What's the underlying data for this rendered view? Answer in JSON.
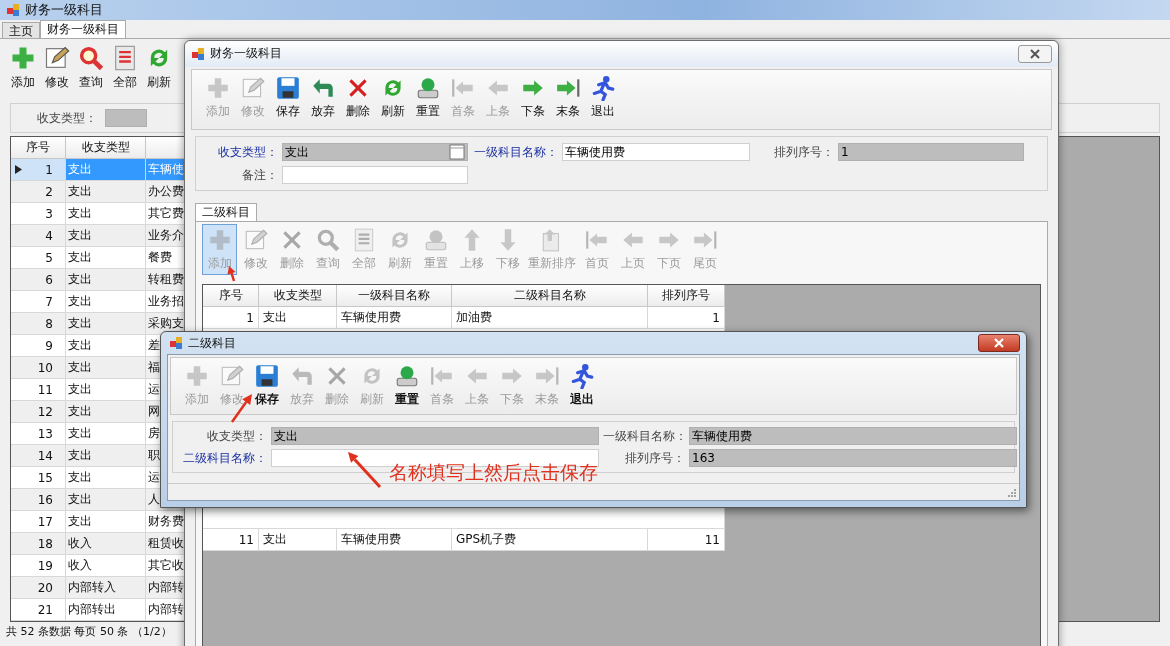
{
  "app_window": {
    "title": "财务一级科目",
    "tabs": [
      {
        "label": "主页",
        "selected": false
      },
      {
        "label": "财务一级科目",
        "selected": true
      }
    ],
    "toolbar": [
      {
        "kind": "add",
        "label": "添加"
      },
      {
        "kind": "edit",
        "label": "修改"
      },
      {
        "kind": "search",
        "label": "查询"
      },
      {
        "kind": "all",
        "label": "全部"
      },
      {
        "kind": "refresh",
        "label": "刷新"
      }
    ],
    "filter": {
      "label": "收支类型："
    },
    "table": {
      "columns": [
        "序号",
        "收支类型"
      ],
      "rows": [
        {
          "cells": [
            "1",
            "支出",
            "车辆使"
          ],
          "selected": true
        },
        {
          "cells": [
            "2",
            "支出",
            "办公费"
          ],
          "selected": false
        },
        {
          "cells": [
            "3",
            "支出",
            "其它费"
          ],
          "selected": false
        },
        {
          "cells": [
            "4",
            "支出",
            "业务介"
          ],
          "selected": false
        },
        {
          "cells": [
            "5",
            "支出",
            "餐费"
          ],
          "selected": false
        },
        {
          "cells": [
            "6",
            "支出",
            "转租费"
          ],
          "selected": false
        },
        {
          "cells": [
            "7",
            "支出",
            "业务招"
          ],
          "selected": false
        },
        {
          "cells": [
            "8",
            "支出",
            "采购支"
          ],
          "selected": false
        },
        {
          "cells": [
            "9",
            "支出",
            "差"
          ],
          "selected": false
        },
        {
          "cells": [
            "10",
            "支出",
            "福"
          ],
          "selected": false
        },
        {
          "cells": [
            "11",
            "支出",
            "运"
          ],
          "selected": false
        },
        {
          "cells": [
            "12",
            "支出",
            "网"
          ],
          "selected": false
        },
        {
          "cells": [
            "13",
            "支出",
            "房"
          ],
          "selected": false
        },
        {
          "cells": [
            "14",
            "支出",
            "职"
          ],
          "selected": false
        },
        {
          "cells": [
            "15",
            "支出",
            "运"
          ],
          "selected": false
        },
        {
          "cells": [
            "16",
            "支出",
            "人"
          ],
          "selected": false
        },
        {
          "cells": [
            "17",
            "支出",
            "财务费"
          ],
          "selected": false
        },
        {
          "cells": [
            "18",
            "收入",
            "租赁收"
          ],
          "selected": false
        },
        {
          "cells": [
            "19",
            "收入",
            "其它收"
          ],
          "selected": false
        },
        {
          "cells": [
            "20",
            "内部转入",
            "内部转"
          ],
          "selected": false
        },
        {
          "cells": [
            "21",
            "内部转出",
            "内部转"
          ],
          "selected": false
        }
      ]
    },
    "status_bar": "共 52 条数据 每页 50 条 （1/2）"
  },
  "main_window": {
    "title": "财务一级科目",
    "toolbar": [
      {
        "kind": "add",
        "label": "添加",
        "disabled": true
      },
      {
        "kind": "edit",
        "label": "修改",
        "disabled": true
      },
      {
        "kind": "save",
        "label": "保存",
        "disabled": false
      },
      {
        "kind": "undo",
        "label": "放弃",
        "disabled": false
      },
      {
        "kind": "delete",
        "label": "删除",
        "disabled": false
      },
      {
        "kind": "refresh",
        "label": "刷新",
        "disabled": false
      },
      {
        "kind": "reset",
        "label": "重置",
        "disabled": false
      },
      {
        "kind": "first",
        "label": "首条",
        "disabled": true
      },
      {
        "kind": "prev",
        "label": "上条",
        "disabled": true
      },
      {
        "kind": "next",
        "label": "下条",
        "disabled": false
      },
      {
        "kind": "last",
        "label": "末条",
        "disabled": false
      },
      {
        "kind": "exit",
        "label": "退出",
        "disabled": false
      }
    ],
    "form": [
      {
        "label": "收支类型：",
        "value": "支出",
        "required": true,
        "readonly": true,
        "picker": true
      },
      {
        "label": "一级科目名称：",
        "value": "车辆使用费",
        "required": true,
        "readonly": false,
        "picker": false
      },
      {
        "label": "排列序号：",
        "value": "1",
        "required": false,
        "readonly": true,
        "picker": false
      },
      {
        "label": "备注：",
        "required": false,
        "readonly": false,
        "picker": false
      }
    ],
    "tabs": [
      {
        "label": "二级科目",
        "selected": true
      }
    ],
    "sub_toolbar": [
      {
        "kind": "add",
        "label": "添加",
        "disabled": true,
        "hovered": true
      },
      {
        "kind": "edit",
        "label": "修改",
        "disabled": true,
        "hovered": false
      },
      {
        "kind": "delete",
        "label": "删除",
        "disabled": true,
        "hovered": false
      },
      {
        "kind": "search",
        "label": "查询",
        "disabled": true,
        "hovered": false
      },
      {
        "kind": "all",
        "label": "全部",
        "disabled": true,
        "hovered": false
      },
      {
        "kind": "refresh",
        "label": "刷新",
        "disabled": true,
        "hovered": false
      },
      {
        "kind": "reset",
        "label": "重置",
        "disabled": true,
        "hovered": false
      },
      {
        "kind": "up",
        "label": "上移",
        "disabled": true,
        "hovered": false
      },
      {
        "kind": "down",
        "label": "下移",
        "disabled": true,
        "hovered": false
      },
      {
        "kind": "resort",
        "label": "重新排序",
        "disabled": true,
        "hovered": false
      },
      {
        "kind": "first",
        "label": "首页",
        "disabled": true,
        "hovered": false
      },
      {
        "kind": "prev",
        "label": "上页",
        "disabled": true,
        "hovered": false
      },
      {
        "kind": "next",
        "label": "下页",
        "disabled": true,
        "hovered": false
      },
      {
        "kind": "last",
        "label": "尾页",
        "disabled": true,
        "hovered": false
      }
    ],
    "table": {
      "columns": [
        "序号",
        "收支类型",
        "一级科目名称",
        "二级科目名称",
        "排列序号"
      ],
      "rows": [
        {
          "cells": [
            "1",
            "支出",
            "车辆使用费",
            "加油费",
            "1"
          ]
        },
        {
          "cells": [
            "11",
            "支出",
            "车辆使用费",
            "GPS机子费",
            "11"
          ]
        }
      ]
    }
  },
  "dialog": {
    "title": "二级科目",
    "toolbar": [
      {
        "kind": "add",
        "label": "添加",
        "disabled": true
      },
      {
        "kind": "edit",
        "label": "修改",
        "disabled": true
      },
      {
        "kind": "save",
        "label": "保存",
        "disabled": false
      },
      {
        "kind": "undo",
        "label": "放弃",
        "disabled": true
      },
      {
        "kind": "delete",
        "label": "删除",
        "disabled": true
      },
      {
        "kind": "refresh",
        "label": "刷新",
        "disabled": true
      },
      {
        "kind": "reset",
        "label": "重置",
        "disabled": false
      },
      {
        "kind": "first",
        "label": "首条",
        "disabled": true
      },
      {
        "kind": "prev",
        "label": "上条",
        "disabled": true
      },
      {
        "kind": "next",
        "label": "下条",
        "disabled": true
      },
      {
        "kind": "last",
        "label": "末条",
        "disabled": true
      },
      {
        "kind": "exit",
        "label": "退出",
        "disabled": false
      }
    ],
    "form": [
      {
        "label": "收支类型：",
        "value": "支出",
        "required": false,
        "readonly": true
      },
      {
        "label": "一级科目名称：",
        "value": "车辆使用费",
        "required": false,
        "readonly": true
      },
      {
        "label": "二级科目名称：",
        "required": true,
        "readonly": false
      },
      {
        "label": "排列序号：",
        "value": "163",
        "required": false,
        "readonly": true
      }
    ]
  },
  "annotation": "名称填写上然后点击保存"
}
